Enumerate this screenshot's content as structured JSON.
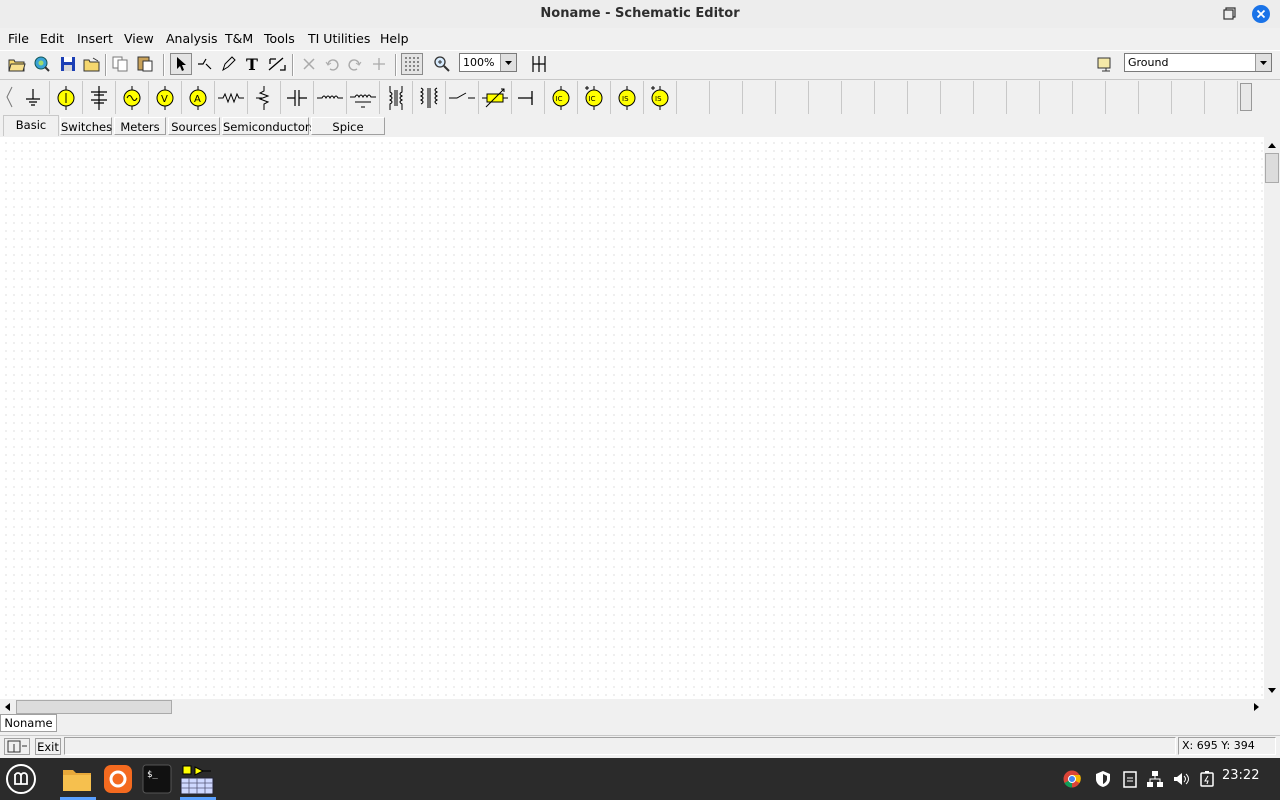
{
  "window": {
    "title": "Noname - Schematic Editor"
  },
  "menubar": [
    "File",
    "Edit",
    "Insert",
    "View",
    "Analysis",
    "T&M",
    "Tools",
    "TI Utilities",
    "Help"
  ],
  "toolbar": {
    "zoom_value": "100%",
    "ground_selector": "Ground",
    "icons": [
      "open-icon",
      "open-example-icon",
      "save-icon",
      "open-folder-icon",
      "copy-icon",
      "paste-icon",
      "select-arrow-icon",
      "wire-icon",
      "pencil-icon",
      "text-icon",
      "edit-icon",
      "delete-icon",
      "undo-icon",
      "redo-icon",
      "junction-icon",
      "grid-toggle-icon",
      "zoom-icon",
      "mirror-icon",
      "ground-tool-icon"
    ]
  },
  "palette": {
    "components": [
      "ground-icon",
      "battery-icon",
      "capacitor-bank-icon",
      "voltage-generator-icon",
      "voltmeter-icon",
      "ammeter-icon",
      "resistor-icon",
      "potentiometer-icon",
      "capacitor-icon",
      "inductor-icon",
      "coupled-inductor-icon",
      "transformer-icon",
      "ideal-transformer-icon",
      "switch-icon",
      "variable-resistor-icon",
      "diode-line-icon",
      "current-source-ic-icon",
      "current-source-ic2-icon",
      "current-source-is-icon",
      "current-source-is2-icon"
    ],
    "tabs": [
      "Basic",
      "Switches",
      "Meters",
      "Sources",
      "Semiconductors",
      "Spice Macros"
    ],
    "active_tab": "Basic"
  },
  "document_tab": "Noname",
  "statusbar": {
    "exit_label": "Exit",
    "coords": "X: 695 Y: 394"
  },
  "taskbar": {
    "apps": [
      "mint-menu-icon",
      "files-icon",
      "firefox-icon",
      "terminal-icon",
      "schematic-app-icon"
    ],
    "tray": [
      "chrome-icon",
      "shield-icon",
      "clipboard-icon",
      "network-icon",
      "volume-icon",
      "battery-icon"
    ],
    "clock": "23:22"
  },
  "colors": {
    "accent": "#1a73e8",
    "component_yellow": "#ffff00",
    "taskbar": "#2b2b2b"
  }
}
